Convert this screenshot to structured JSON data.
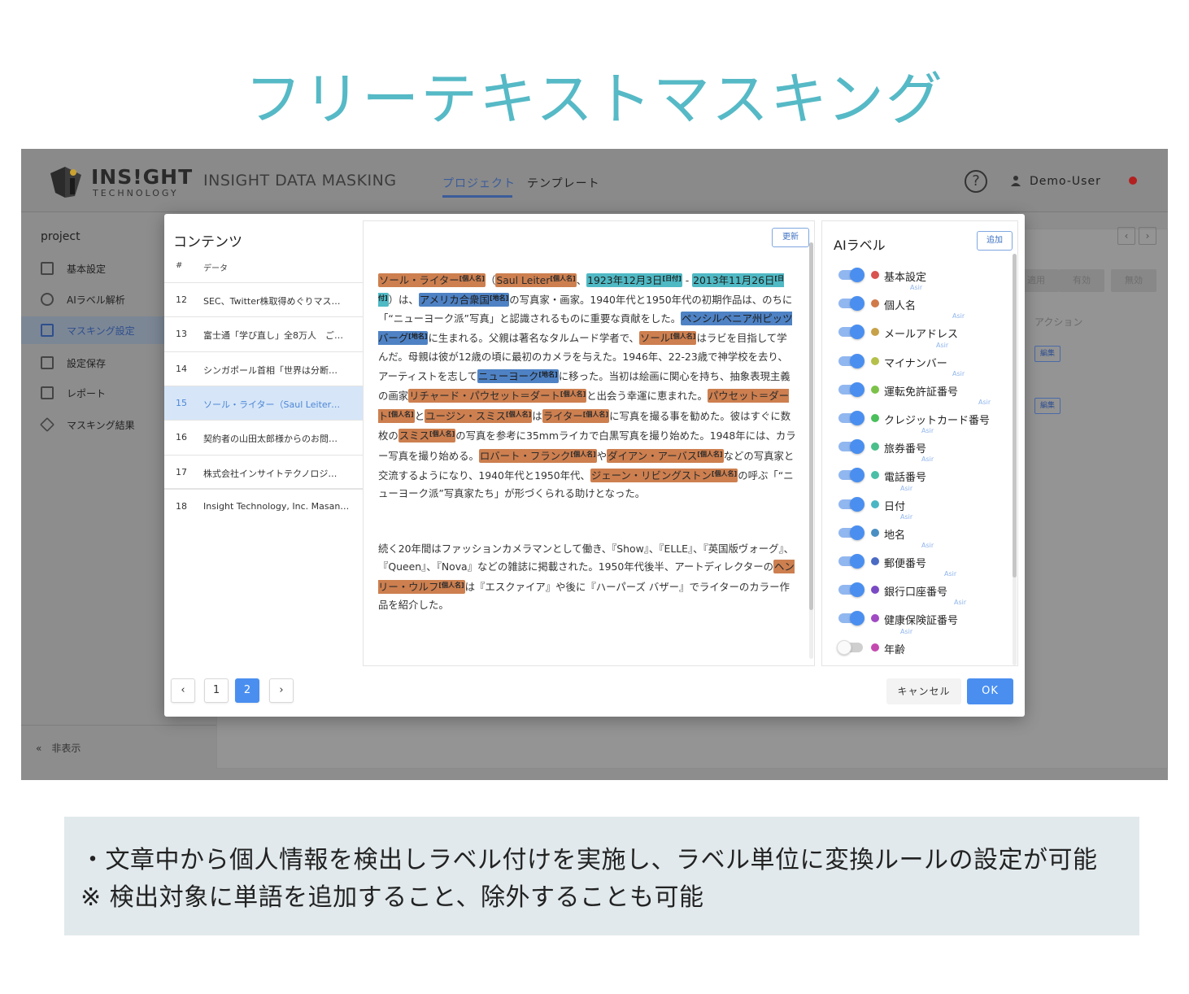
{
  "page_title": "フリーテキストマスキング",
  "app": {
    "logo_text": "INS!GHT",
    "logo_sub": "TECHNOLOGY",
    "product_name": "INSIGHT DATA MASKING",
    "nav": {
      "project": "プロジェクト",
      "template": "テンプレート"
    },
    "help_symbol": "?",
    "user_name": "Demo-User",
    "icons": [
      "logo-mark",
      "help-icon",
      "user-icon",
      "flag-icon"
    ]
  },
  "sidebar": {
    "project": "project",
    "items": [
      {
        "label": "基本設定",
        "icon": "document-icon"
      },
      {
        "label": "AIラベル解析",
        "icon": "brain-icon"
      },
      {
        "label": "マスキング設定",
        "icon": "table-icon"
      },
      {
        "label": "設定保存",
        "icon": "save-icon"
      },
      {
        "label": "レポート",
        "icon": "report-icon"
      },
      {
        "label": "マスキング結果",
        "icon": "cube-icon"
      }
    ],
    "hide": "«　非表示"
  },
  "background": {
    "apply": "適用",
    "enabled": "有効",
    "disabled": "無効",
    "action_header": "アクション",
    "edit": "編集",
    "prev": "‹",
    "next": "›"
  },
  "modal": {
    "contents": {
      "title": "コンテンツ",
      "col_num": "#",
      "col_data": "データ",
      "rows": [
        {
          "num": "12",
          "text": "SEC、Twitter株取得めぐりマス…"
        },
        {
          "num": "13",
          "text": "富士通「学び直し」全8万人　ご…"
        },
        {
          "num": "14",
          "text": "シンガポール首相「世界は分断…"
        },
        {
          "num": "15",
          "text": "ソール・ライター（Saul Leiter…"
        },
        {
          "num": "16",
          "text": "契約者の山田太郎様からのお問…"
        },
        {
          "num": "17",
          "text": "株式会社インサイトテクノロジ…"
        },
        {
          "num": "18",
          "text": "Insight Technology, Inc. Masan…"
        }
      ],
      "selected_num": "15"
    },
    "pagination": {
      "prev": "‹",
      "next": "›",
      "pages": [
        "1",
        "2"
      ],
      "current": "2"
    },
    "text": {
      "refresh": "更新",
      "tags": {
        "person": "[個人名]",
        "date": "[日付]",
        "place": "[地名]"
      },
      "paragraph1": [
        {
          "t": "ソール・ライター",
          "tag": "person"
        },
        {
          "t": "（"
        },
        {
          "t": "Saul Leiter",
          "tag": "person"
        },
        {
          "t": "、"
        },
        {
          "t": "1923年12月3日",
          "tag": "date"
        },
        {
          "t": " - "
        },
        {
          "t": "2013年11月26日",
          "tag": "date"
        },
        {
          "t": "）は、"
        },
        {
          "t": "アメリカ合衆国",
          "tag": "place"
        },
        {
          "t": "の写真家・画家。1940年代と1950年代の初期作品は、のちに「“ニューヨーク派”写真」と認識されるものに重要な貢献をした。"
        },
        {
          "t": "ペンシルベニア州ピッツバーグ",
          "tag": "place"
        },
        {
          "t": "に生まれる。父親は著名なタルムード学者で、"
        },
        {
          "t": "ソール",
          "tag": "person"
        },
        {
          "t": "はラビを目指して学んだ。母親は彼が12歳の頃に最初のカメラを与えた。1946年、22-23歳で神学校を去り、アーティストを志して"
        },
        {
          "t": "ニューヨーク",
          "tag": "place"
        },
        {
          "t": "に移った。当初は絵画に関心を持ち、抽象表現主義の画家"
        },
        {
          "t": "リチャード・パウセット＝ダート",
          "tag": "person"
        },
        {
          "t": "と出会う幸運に恵まれた。"
        },
        {
          "t": "パウセット＝ダート",
          "tag": "person"
        },
        {
          "t": "と"
        },
        {
          "t": "ユージン・スミス",
          "tag": "person"
        },
        {
          "t": "は"
        },
        {
          "t": "ライター",
          "tag": "person"
        },
        {
          "t": "に写真を撮る事を勧めた。彼はすぐに数枚の"
        },
        {
          "t": "スミス",
          "tag": "person"
        },
        {
          "t": "の写真を参考に35mmライカで白黒写真を撮り始めた。1948年には、カラー写真を撮り始める。"
        },
        {
          "t": "ロバート・フランク",
          "tag": "person"
        },
        {
          "t": "や"
        },
        {
          "t": "ダイアン・アーバス",
          "tag": "person"
        },
        {
          "t": "などの写真家と交流するようになり、1940年代と1950年代、"
        },
        {
          "t": "ジェーン・リビングストン",
          "tag": "person"
        },
        {
          "t": "の呼ぶ「“ニューヨーク派”写真家たち」が形づくられる助けとなった。"
        }
      ],
      "paragraph2": [
        {
          "t": "続く20年間はファッションカメラマンとして働き、『Show』、『ELLE』、『英国版ヴォーグ』、『Queen』、『Nova』などの雑誌に掲載された。1950年代後半、アートディレクターの"
        },
        {
          "t": "ヘンリー・ウルフ",
          "tag": "person"
        },
        {
          "t": "は『エスクァイア』や後に『ハーパーズ バザー』でライターのカラー作品を紹介した。"
        }
      ]
    },
    "labels": {
      "title": "AIラベル",
      "add": "追加",
      "badge": "Asir",
      "items": [
        {
          "name": "基本設定",
          "color": "#d9534f",
          "on": true
        },
        {
          "name": "個人名",
          "color": "#d07a4a",
          "on": true
        },
        {
          "name": "メールアドレス",
          "color": "#c8a24a",
          "on": true
        },
        {
          "name": "マイナンバー",
          "color": "#b5c04a",
          "on": true
        },
        {
          "name": "運転免許証番号",
          "color": "#7cc24a",
          "on": true
        },
        {
          "name": "クレジットカード番号",
          "color": "#4abf5c",
          "on": true
        },
        {
          "name": "旅券番号",
          "color": "#4abf8a",
          "on": true
        },
        {
          "name": "電話番号",
          "color": "#4abfa8",
          "on": true
        },
        {
          "name": "日付",
          "color": "#4ab6c4",
          "on": true
        },
        {
          "name": "地名",
          "color": "#4a8fc4",
          "on": true
        },
        {
          "name": "郵便番号",
          "color": "#4a6ac4",
          "on": true
        },
        {
          "name": "銀行口座番号",
          "color": "#7a4ac4",
          "on": true
        },
        {
          "name": "健康保険証番号",
          "color": "#a04ac4",
          "on": true
        },
        {
          "name": "年齢",
          "color": "#c44ab0",
          "on": false
        }
      ]
    },
    "cancel": "キャンセル",
    "ok": "OK"
  },
  "description": {
    "line1": "・文章中から個人情報を検出しラベル付けを実施し、ラベル単位に変換ルールの設定が可能",
    "line2": "※ 検出対象に単語を追加すること、除外することも可能"
  }
}
